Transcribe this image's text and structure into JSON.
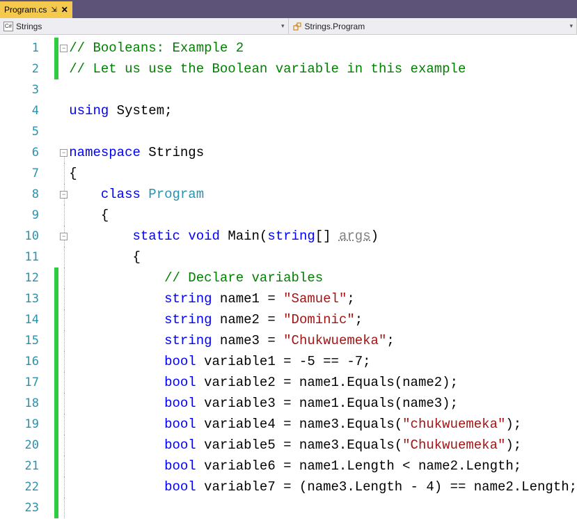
{
  "tab": {
    "title": "Program.cs",
    "pin": "⇲",
    "close": "✕"
  },
  "nav": {
    "left": {
      "icon_label": "C#",
      "text": "Strings"
    },
    "right": {
      "text": "Strings.Program"
    },
    "dropdown_glyph": "▾"
  },
  "lines": [
    {
      "n": 1,
      "marker": true,
      "fold": "box",
      "html": [
        [
          "c-comment",
          "// Booleans: Example 2"
        ]
      ]
    },
    {
      "n": 2,
      "marker": true,
      "html": [
        [
          "c-comment",
          "// Let us use the Boolean variable in this example"
        ]
      ]
    },
    {
      "n": 3,
      "html": []
    },
    {
      "n": 4,
      "html": [
        [
          "c-keyword",
          "using"
        ],
        [
          "c-text",
          " System;"
        ]
      ]
    },
    {
      "n": 5,
      "html": []
    },
    {
      "n": 6,
      "fold": "box",
      "html": [
        [
          "c-keyword",
          "namespace"
        ],
        [
          "c-text",
          " Strings"
        ]
      ]
    },
    {
      "n": 7,
      "html": [
        [
          "c-text",
          "{"
        ]
      ]
    },
    {
      "n": 8,
      "fold": "box",
      "html": [
        [
          "c-text",
          "    "
        ],
        [
          "c-keyword",
          "class"
        ],
        [
          "c-text",
          " "
        ],
        [
          "c-type",
          "Program"
        ]
      ]
    },
    {
      "n": 9,
      "html": [
        [
          "c-text",
          "    {"
        ]
      ]
    },
    {
      "n": 10,
      "fold": "box",
      "html": [
        [
          "c-text",
          "        "
        ],
        [
          "c-keyword",
          "static"
        ],
        [
          "c-text",
          " "
        ],
        [
          "c-keyword",
          "void"
        ],
        [
          "c-text",
          " Main("
        ],
        [
          "c-keyword",
          "string"
        ],
        [
          "c-text",
          "[] "
        ],
        [
          "c-param",
          "args"
        ],
        [
          "c-text",
          ")"
        ]
      ]
    },
    {
      "n": 11,
      "html": [
        [
          "c-text",
          "        {"
        ]
      ]
    },
    {
      "n": 12,
      "marker": true,
      "html": [
        [
          "c-text",
          "            "
        ],
        [
          "c-comment",
          "// Declare variables"
        ]
      ]
    },
    {
      "n": 13,
      "marker": true,
      "html": [
        [
          "c-text",
          "            "
        ],
        [
          "c-keyword",
          "string"
        ],
        [
          "c-text",
          " name1 = "
        ],
        [
          "c-string",
          "\"Samuel\""
        ],
        [
          "c-text",
          ";"
        ]
      ]
    },
    {
      "n": 14,
      "marker": true,
      "html": [
        [
          "c-text",
          "            "
        ],
        [
          "c-keyword",
          "string"
        ],
        [
          "c-text",
          " name2 = "
        ],
        [
          "c-string",
          "\"Dominic\""
        ],
        [
          "c-text",
          ";"
        ]
      ]
    },
    {
      "n": 15,
      "marker": true,
      "html": [
        [
          "c-text",
          "            "
        ],
        [
          "c-keyword",
          "string"
        ],
        [
          "c-text",
          " name3 = "
        ],
        [
          "c-string",
          "\"Chukwuemeka\""
        ],
        [
          "c-text",
          ";"
        ]
      ]
    },
    {
      "n": 16,
      "marker": true,
      "html": [
        [
          "c-text",
          "            "
        ],
        [
          "c-keyword",
          "bool"
        ],
        [
          "c-text",
          " variable1 = -5 == -7;"
        ]
      ]
    },
    {
      "n": 17,
      "marker": true,
      "html": [
        [
          "c-text",
          "            "
        ],
        [
          "c-keyword",
          "bool"
        ],
        [
          "c-text",
          " variable2 = name1.Equals(name2);"
        ]
      ]
    },
    {
      "n": 18,
      "marker": true,
      "html": [
        [
          "c-text",
          "            "
        ],
        [
          "c-keyword",
          "bool"
        ],
        [
          "c-text",
          " variable3 = name1.Equals(name3);"
        ]
      ]
    },
    {
      "n": 19,
      "marker": true,
      "html": [
        [
          "c-text",
          "            "
        ],
        [
          "c-keyword",
          "bool"
        ],
        [
          "c-text",
          " variable4 = name3.Equals("
        ],
        [
          "c-string",
          "\"chukwuemeka\""
        ],
        [
          "c-text",
          ");"
        ]
      ]
    },
    {
      "n": 20,
      "marker": true,
      "html": [
        [
          "c-text",
          "            "
        ],
        [
          "c-keyword",
          "bool"
        ],
        [
          "c-text",
          " variable5 = name3.Equals("
        ],
        [
          "c-string",
          "\"Chukwuemeka\""
        ],
        [
          "c-text",
          ");"
        ]
      ]
    },
    {
      "n": 21,
      "marker": true,
      "html": [
        [
          "c-text",
          "            "
        ],
        [
          "c-keyword",
          "bool"
        ],
        [
          "c-text",
          " variable6 = name1.Length < name2.Length;"
        ]
      ]
    },
    {
      "n": 22,
      "marker": true,
      "html": [
        [
          "c-text",
          "            "
        ],
        [
          "c-keyword",
          "bool"
        ],
        [
          "c-text",
          " variable7 = (name3.Length - 4) == name2.Length;"
        ]
      ]
    },
    {
      "n": 23,
      "marker": true,
      "html": []
    }
  ]
}
